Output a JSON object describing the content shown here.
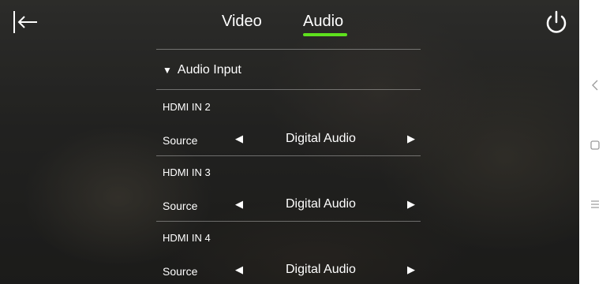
{
  "tabs": {
    "video": "Video",
    "audio": "Audio"
  },
  "clipped_text": "…",
  "section": {
    "title": "Audio Input"
  },
  "inputs": [
    {
      "name": "HDMI IN 2",
      "row_label": "Source",
      "value": "Digital Audio"
    },
    {
      "name": "HDMI IN 3",
      "row_label": "Source",
      "value": "Digital Audio"
    },
    {
      "name": "HDMI IN 4",
      "row_label": "Source",
      "value": "Digital Audio"
    }
  ],
  "arrows": {
    "left": "◀",
    "right": "▶"
  },
  "colors": {
    "accent": "#5ee11d",
    "text": "#ffffff",
    "navbar_bg": "#ffffff",
    "navbar_icon": "#9a9a9a"
  },
  "icons": {
    "back": "back-arrow-icon",
    "power": "power-icon",
    "expand": "triangle-down-icon",
    "nav_back": "chevron-left-icon",
    "nav_home": "square-icon",
    "nav_menu": "menu-icon"
  }
}
